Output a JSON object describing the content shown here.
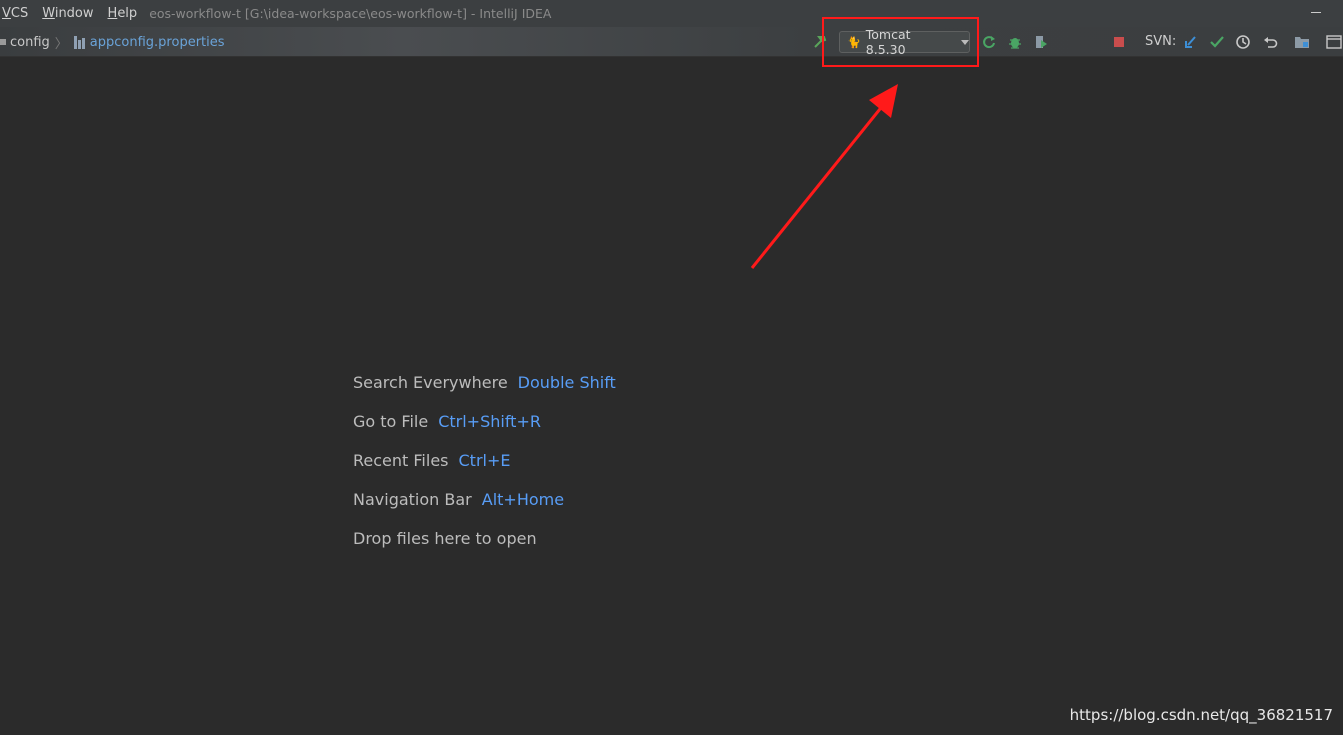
{
  "menu": {
    "items": [
      {
        "label": "VCS",
        "mnemonic": "V"
      },
      {
        "label": "Window",
        "mnemonic": "W"
      },
      {
        "label": "Help",
        "mnemonic": "H"
      }
    ],
    "window_title": "eos-workflow-t [G:\\idea-workspace\\eos-workflow-t] - IntelliJ IDEA"
  },
  "breadcrumb": {
    "folder": "config",
    "file": "appconfig.properties"
  },
  "toolbar": {
    "run_config": "Tomcat 8.5.30",
    "svn_label": "SVN:",
    "icons": [
      "build-hammer-icon",
      "tomcat-icon",
      "rerun-icon",
      "debug-bug-icon",
      "coverage-icon",
      "stop-icon",
      "svn-update-icon",
      "svn-commit-icon",
      "history-icon",
      "revert-icon",
      "project-structure-icon",
      "terminal-icon"
    ]
  },
  "editor": {
    "hints": [
      {
        "label": "Search Everywhere",
        "shortcut": "Double Shift"
      },
      {
        "label": "Go to File",
        "shortcut": "Ctrl+Shift+R"
      },
      {
        "label": "Recent Files",
        "shortcut": "Ctrl+E"
      },
      {
        "label": "Navigation Bar",
        "shortcut": "Alt+Home"
      },
      {
        "label": "Drop files here to open",
        "shortcut": ""
      }
    ]
  },
  "watermark": "https://blog.csdn.net/qq_36821517",
  "colors": {
    "annotation": "#ff1a1a",
    "shortcut": "#589df6",
    "background": "#2b2b2b"
  }
}
